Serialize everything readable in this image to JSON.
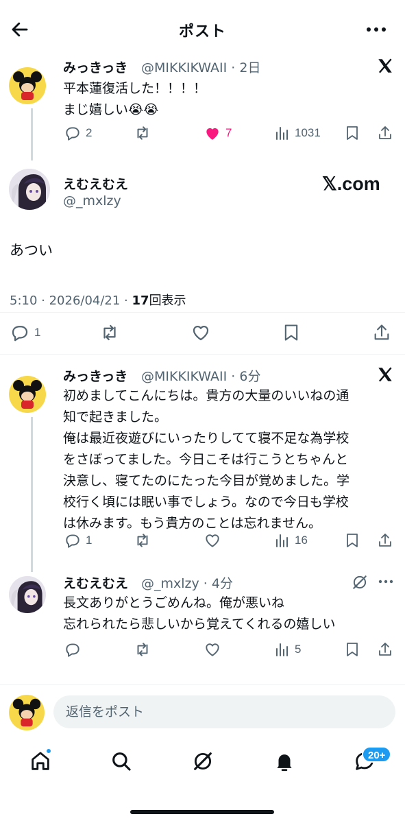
{
  "header": {
    "title": "ポスト"
  },
  "colors": {
    "accent": "#1d9bf0",
    "like": "#f91880",
    "text": "#0f1419",
    "muted": "#536471"
  },
  "tweet1": {
    "name": "みっきっき",
    "meta": "@MIKKIKWAII · 2日",
    "lines": "平本蓮復活した！！！！\nまじ嬉しい😭😭",
    "replies": "2",
    "likes": "7",
    "views": "1031"
  },
  "main": {
    "name": "えむえむえ",
    "handle": "@_mxlzy",
    "site": "𝕏.com",
    "text": "あつい",
    "time": "5:10 · 2026/04/21 · ",
    "views_count": "17",
    "views_label": "回表示",
    "replies": "1"
  },
  "reply1": {
    "name": "みっきっき",
    "meta": "@MIKKIKWAII · 6分",
    "lines": "初めましてこんにちは。貴方の大量のいいねの通\n知で起きました。\n俺は最近夜遊びにいったりしてて寝不足な為学校\nをさぼってました。今日こそは行こうとちゃんと\n決意し、寝てたのにたった今目が覚めました。学\n校行く頃には眠い事でしょう。なので今日も学校\nは休みます。もう貴方のことは忘れません。",
    "replies": "1",
    "views": "16"
  },
  "reply2": {
    "name": "えむえむえ",
    "meta": "@_mxlzy · 4分",
    "lines": "長文ありがとうごめんね。俺が悪いね\n忘れられたら悲しいから覚えてくれるの嬉しい",
    "views": "5"
  },
  "composer": {
    "placeholder": "返信をポスト"
  },
  "nav": {
    "messages_badge": "20+"
  }
}
